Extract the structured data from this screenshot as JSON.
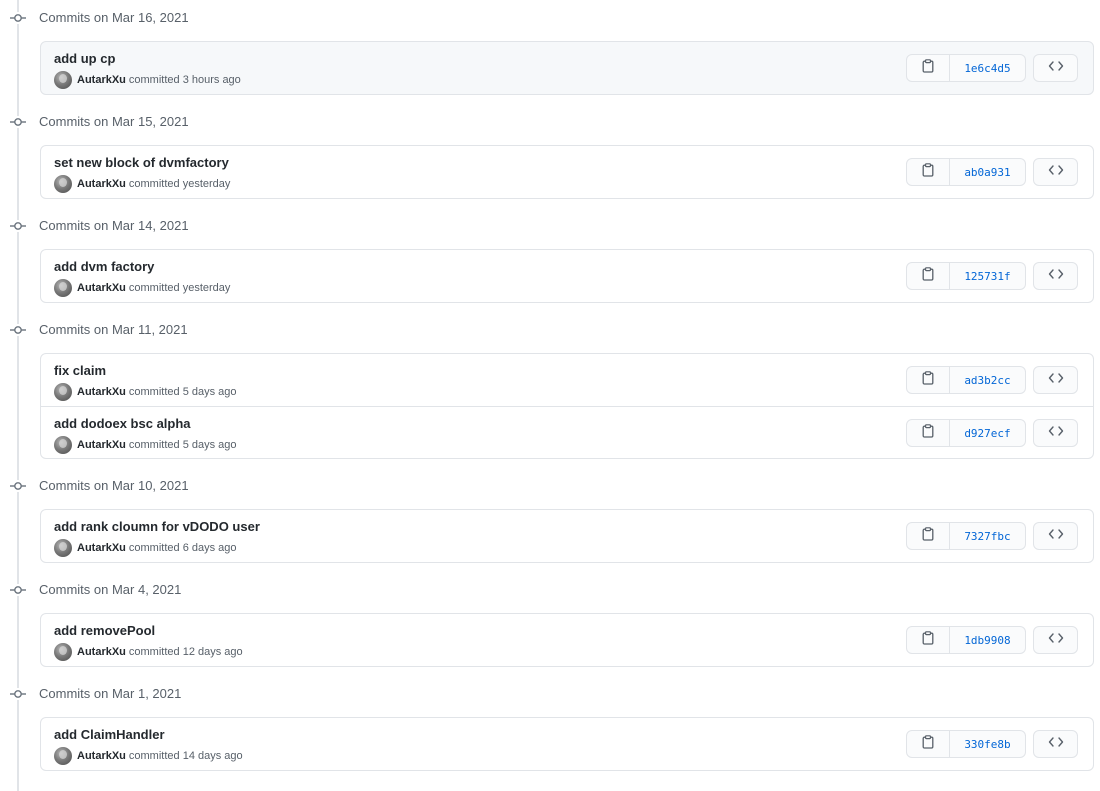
{
  "groups": [
    {
      "title": "Commits on Mar 16, 2021",
      "commits": [
        {
          "message": "add up cp",
          "author": "AutarkXu",
          "time": "committed 3 hours ago",
          "sha": "1e6c4d5"
        }
      ]
    },
    {
      "title": "Commits on Mar 15, 2021",
      "commits": [
        {
          "message": "set new block of dvmfactory",
          "author": "AutarkXu",
          "time": "committed yesterday",
          "sha": "ab0a931"
        }
      ]
    },
    {
      "title": "Commits on Mar 14, 2021",
      "commits": [
        {
          "message": "add dvm factory",
          "author": "AutarkXu",
          "time": "committed yesterday",
          "sha": "125731f"
        }
      ]
    },
    {
      "title": "Commits on Mar 11, 2021",
      "commits": [
        {
          "message": "fix claim",
          "author": "AutarkXu",
          "time": "committed 5 days ago",
          "sha": "ad3b2cc"
        },
        {
          "message": "add dodoex bsc alpha",
          "author": "AutarkXu",
          "time": "committed 5 days ago",
          "sha": "d927ecf"
        }
      ]
    },
    {
      "title": "Commits on Mar 10, 2021",
      "commits": [
        {
          "message": "add rank cloumn for vDODO user",
          "author": "AutarkXu",
          "time": "committed 6 days ago",
          "sha": "7327fbc"
        }
      ]
    },
    {
      "title": "Commits on Mar 4, 2021",
      "commits": [
        {
          "message": "add removePool",
          "author": "AutarkXu",
          "time": "committed 12 days ago",
          "sha": "1db9908"
        }
      ]
    },
    {
      "title": "Commits on Mar 1, 2021",
      "commits": [
        {
          "message": "add ClaimHandler",
          "author": "AutarkXu",
          "time": "committed 14 days ago",
          "sha": "330fe8b"
        }
      ]
    }
  ],
  "icons": {
    "timeline": "git-commit-icon",
    "copy": "clipboard-icon",
    "browse": "code-icon"
  },
  "colors": {
    "sha_link": "#0366d6",
    "border": "#e1e4e8",
    "muted_text": "#586069",
    "highlight_bg": "#f6f8fa"
  }
}
